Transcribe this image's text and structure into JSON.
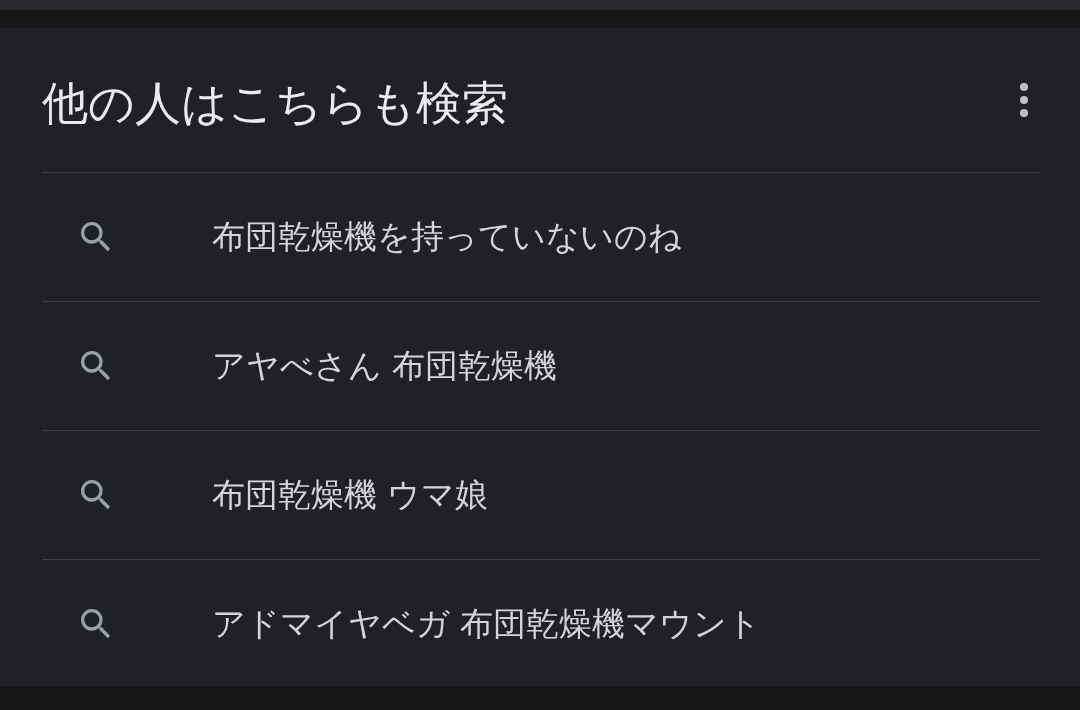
{
  "section": {
    "title": "他の人はこちらも検索",
    "items": [
      {
        "text": "布団乾燥機を持っていないのね"
      },
      {
        "text": "アヤべさん 布団乾燥機"
      },
      {
        "text": "布団乾燥機 ウマ娘"
      },
      {
        "text": "アドマイヤベガ 布団乾燥機マウント"
      }
    ]
  }
}
